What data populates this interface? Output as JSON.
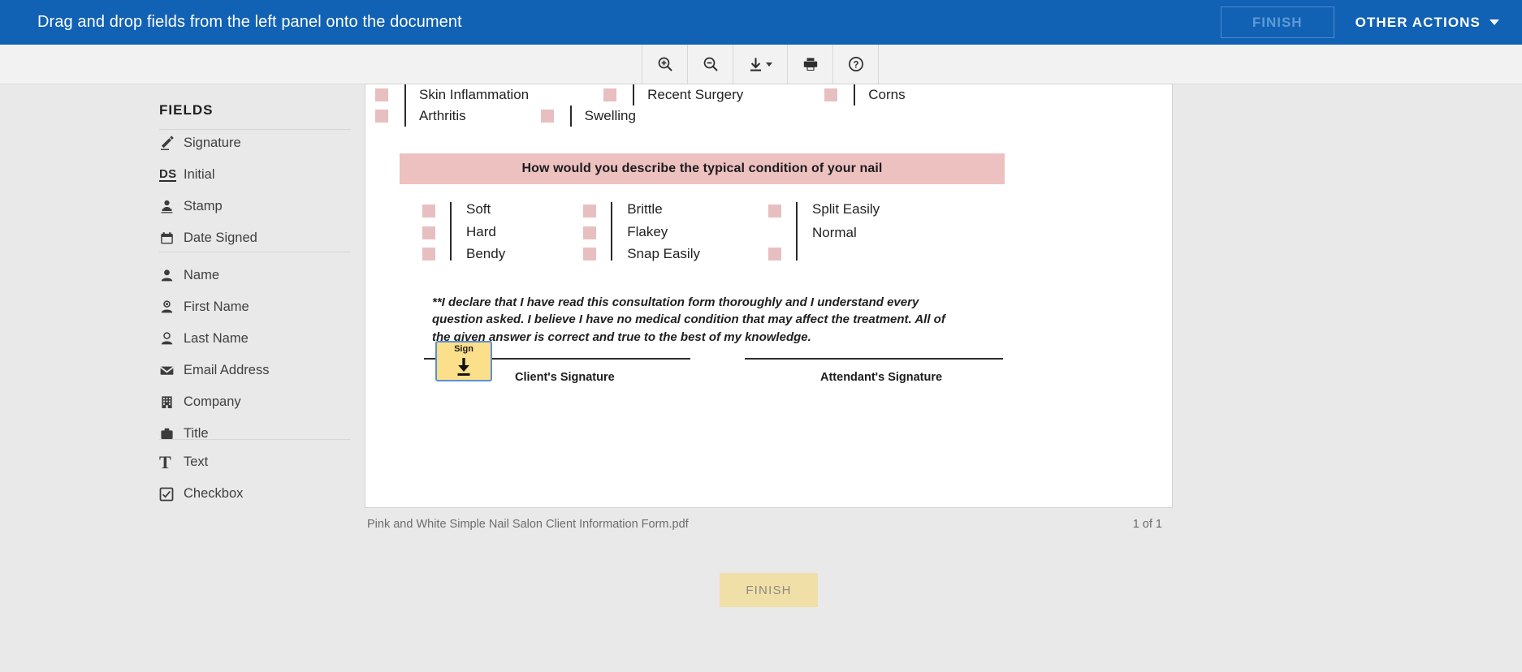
{
  "topbar": {
    "instruction": "Drag and drop fields from the left panel onto the document",
    "finish_label": "FINISH",
    "other_actions_label": "OTHER ACTIONS",
    "background_color": "#1161b4"
  },
  "toolbar": {
    "buttons": [
      {
        "name": "zoom-in-icon",
        "title": "Zoom In"
      },
      {
        "name": "zoom-out-icon",
        "title": "Zoom Out"
      },
      {
        "name": "download-icon",
        "title": "Download"
      },
      {
        "name": "print-icon",
        "title": "Print"
      },
      {
        "name": "help-icon",
        "title": "Help"
      }
    ]
  },
  "sidebar": {
    "title": "FIELDS",
    "groups": [
      {
        "items": [
          {
            "label": "Signature",
            "icon": "pen-icon"
          },
          {
            "label": "Initial",
            "icon": "ds-icon"
          },
          {
            "label": "Stamp",
            "icon": "stamp-icon"
          },
          {
            "label": "Date Signed",
            "icon": "calendar-icon"
          }
        ]
      },
      {
        "items": [
          {
            "label": "Name",
            "icon": "person-icon"
          },
          {
            "label": "First Name",
            "icon": "person-first-icon"
          },
          {
            "label": "Last Name",
            "icon": "person-last-icon"
          },
          {
            "label": "Email Address",
            "icon": "envelope-icon"
          },
          {
            "label": "Company",
            "icon": "building-icon"
          },
          {
            "label": "Title",
            "icon": "briefcase-icon"
          }
        ]
      },
      {
        "items": [
          {
            "label": "Text",
            "icon": "text-icon"
          },
          {
            "label": "Checkbox",
            "icon": "checkbox-icon"
          }
        ]
      }
    ]
  },
  "document": {
    "filename": "Pink and White Simple Nail Salon Client Information Form.pdf",
    "page_indicator": "1 of 1",
    "top_conditions": [
      [
        "Skin Inflammation",
        "Recent Surgery",
        "Corns"
      ],
      [
        "Arthritis",
        "Swelling"
      ]
    ],
    "banner_text": "How would you describe the typical condition of your nail",
    "nail_conditions": [
      [
        "Soft",
        "Hard",
        "Bendy"
      ],
      [
        "Brittle",
        "Flakey",
        "Snap Easily"
      ],
      [
        "Split Easily",
        "Normal"
      ]
    ],
    "declaration": "**I declare that I have read this consultation form thoroughly and I understand every question asked. I believe I have no medical condition that may affect the treatment. All of the given answer is correct and true to the best of my knowledge.",
    "signature_labels": {
      "client": "Client's Signature",
      "attendant": "Attendant's Signature"
    },
    "sign_tag": {
      "label": "Sign",
      "fill_color": "#fbdf8b",
      "border_color": "#5b8fd4"
    },
    "checkbox_color": "#e8bfc0",
    "banner_color": "#eec1c1"
  },
  "footer": {
    "finish_label": "FINISH",
    "finish_color": "#f0e0a8"
  }
}
